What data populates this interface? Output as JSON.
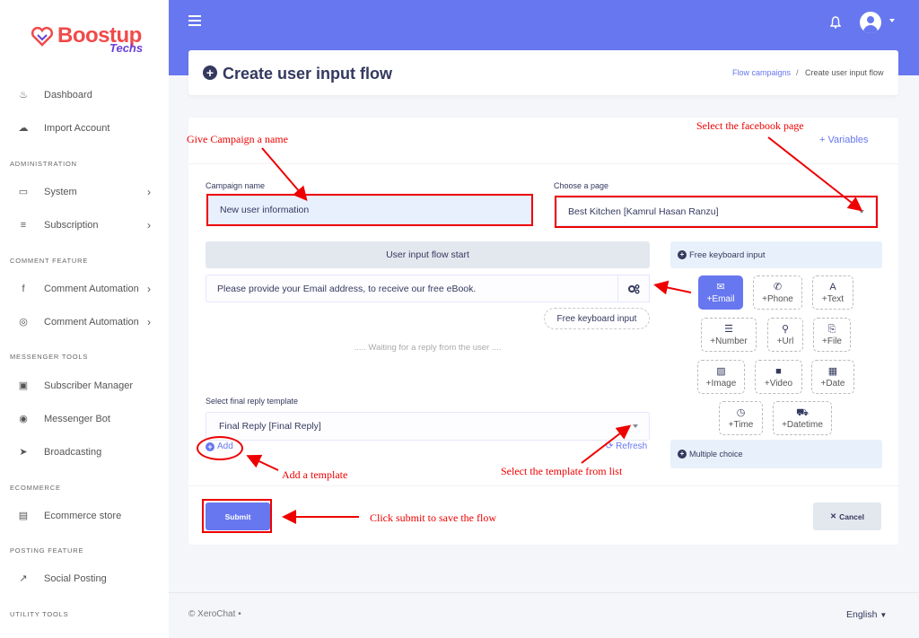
{
  "brand": {
    "name": "Boostup",
    "sub": "Techs"
  },
  "sidebar": {
    "items": [
      {
        "label": "Dashboard",
        "icon": "fire-icon",
        "glyph": "♨"
      },
      {
        "label": "Import Account",
        "icon": "cloud-upload-icon",
        "glyph": "☁"
      },
      {
        "label": "System",
        "icon": "monitor-icon",
        "glyph": "▭"
      },
      {
        "label": "Subscription",
        "icon": "coins-icon",
        "glyph": "≡"
      },
      {
        "label": "Comment Automation",
        "icon": "facebook-icon",
        "glyph": "f"
      },
      {
        "label": "Comment Automation",
        "icon": "instagram-icon",
        "glyph": "◎"
      },
      {
        "label": "Subscriber Manager",
        "icon": "address-book-icon",
        "glyph": "▣"
      },
      {
        "label": "Messenger Bot",
        "icon": "robot-icon",
        "glyph": "◉"
      },
      {
        "label": "Broadcasting",
        "icon": "paper-plane-icon",
        "glyph": "➤"
      },
      {
        "label": "Ecommerce store",
        "icon": "store-icon",
        "glyph": "▤"
      },
      {
        "label": "Social Posting",
        "icon": "share-square-icon",
        "glyph": "↗"
      }
    ],
    "headers": [
      "ADMINISTRATION",
      "COMMENT FEATURE",
      "MESSENGER TOOLS",
      "ECOMMERCE",
      "POSTING FEATURE",
      "UTILITY TOOLS"
    ]
  },
  "header": {
    "title": "Create user input flow",
    "breadcrumb": {
      "link": "Flow campaigns",
      "separator": "/",
      "current": "Create user input flow"
    }
  },
  "form": {
    "variables_link": "Variables",
    "campaign_label": "Campaign name",
    "campaign_value": "New user information",
    "page_label": "Choose a page",
    "page_value": "Best Kitchen [Kamrul Hasan Ranzu]",
    "flow_start": "User input flow start",
    "question_value": "Please provide your Email address, to receive our free eBook.",
    "free_keyboard_button": "Free keyboard input",
    "waiting_text": "..... Waiting for a reply from the user ....",
    "final_label": "Select final reply template",
    "final_value": "Final Reply [Final Reply]",
    "add_label": "Add",
    "refresh_label": "Refresh",
    "submit_label": "Submit",
    "cancel_label": "Cancel"
  },
  "panel": {
    "free_keyboard_title": "Free keyboard input",
    "multiple_choice_title": "Multiple choice",
    "types": [
      {
        "label": "Email",
        "glyph": "✉",
        "icon": "envelope-icon"
      },
      {
        "label": "Phone",
        "glyph": "✆",
        "icon": "phone-icon"
      },
      {
        "label": "Text",
        "glyph": "A",
        "icon": "text-icon"
      },
      {
        "label": "Number",
        "glyph": "☰",
        "icon": "list-ol-icon"
      },
      {
        "label": "Url",
        "glyph": "⚲",
        "icon": "link-icon"
      },
      {
        "label": "File",
        "glyph": "⎘",
        "icon": "paperclip-icon"
      },
      {
        "label": "Image",
        "glyph": "▨",
        "icon": "image-icon"
      },
      {
        "label": "Video",
        "glyph": "■",
        "icon": "video-icon"
      },
      {
        "label": "Date",
        "glyph": "▦",
        "icon": "calendar-icon"
      },
      {
        "label": "Time",
        "glyph": "◷",
        "icon": "clock-icon"
      },
      {
        "label": "Datetime",
        "glyph": "⛟",
        "icon": "calendar-clock-icon"
      }
    ]
  },
  "annotations": {
    "campaign_name": "Give Campaign a name",
    "facebook_page": "Select the facebook page",
    "add_template": "Add a template",
    "select_template": "Select the template from list",
    "submit": "Click submit to save the flow"
  },
  "footer": {
    "copyright": "© XeroChat",
    "language": "English"
  },
  "colors": {
    "accent": "#6777ef",
    "annotation": "#ee0000",
    "sidebar_bg": "#ffffff"
  }
}
